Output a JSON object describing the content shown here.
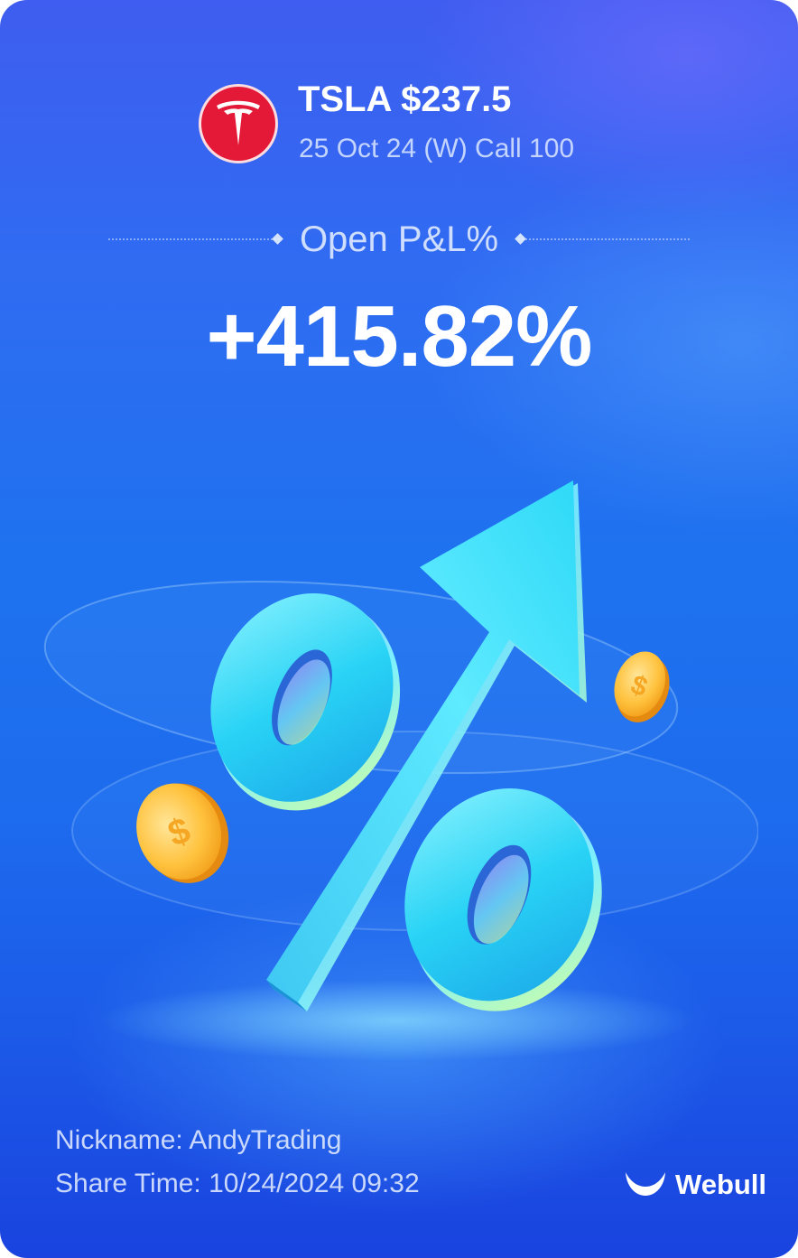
{
  "position": {
    "ticker": "TSLA",
    "price": "$237.5",
    "contract": "25 Oct 24 (W) Call 100",
    "logo_icon": "tesla-logo-icon",
    "logo_color": "#e31937"
  },
  "pnl": {
    "label": "Open P&L%",
    "value": "+415.82%"
  },
  "footer": {
    "nickname": "Nickname: AndyTrading",
    "share_time": "Share Time: 10/24/2024 09:32",
    "brand_name": "Webull",
    "brand_icon": "webull-bull-icon"
  },
  "illustration": {
    "description_icons": [
      "percent-icon",
      "arrow-up-icon",
      "coin-icon"
    ]
  }
}
